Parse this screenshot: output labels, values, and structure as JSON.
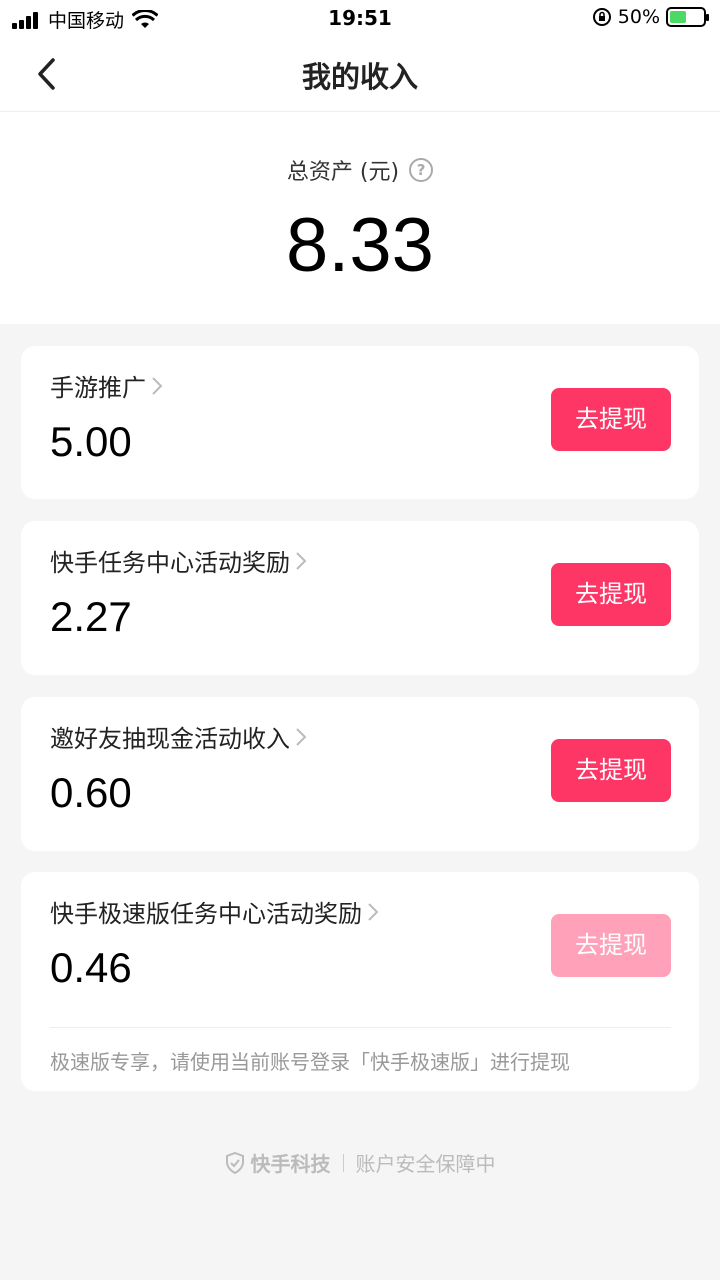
{
  "status_bar": {
    "carrier": "中国移动",
    "time": "19:51",
    "battery": "50%",
    "battery_level": 0.5
  },
  "nav": {
    "title": "我的收入"
  },
  "summary": {
    "label": "总资产 (元)",
    "help": "?",
    "amount": "8.33"
  },
  "cards": [
    {
      "title": "手游推广",
      "amount": "5.00",
      "button": "去提现",
      "enabled": true
    },
    {
      "title": "快手任务中心活动奖励",
      "amount": "2.27",
      "button": "去提现",
      "enabled": true
    },
    {
      "title": "邀好友抽现金活动收入",
      "amount": "0.60",
      "button": "去提现",
      "enabled": true
    },
    {
      "title": "快手极速版任务中心活动奖励",
      "amount": "0.46",
      "button": "去提现",
      "enabled": false,
      "note": "极速版专享，请使用当前账号登录「快手极速版」进行提现"
    }
  ],
  "footer": {
    "brand": "快手科技",
    "text": "账户安全保障中"
  },
  "colors": {
    "accent": "#fe3666",
    "accent_disabled": "#ffa1b8"
  }
}
